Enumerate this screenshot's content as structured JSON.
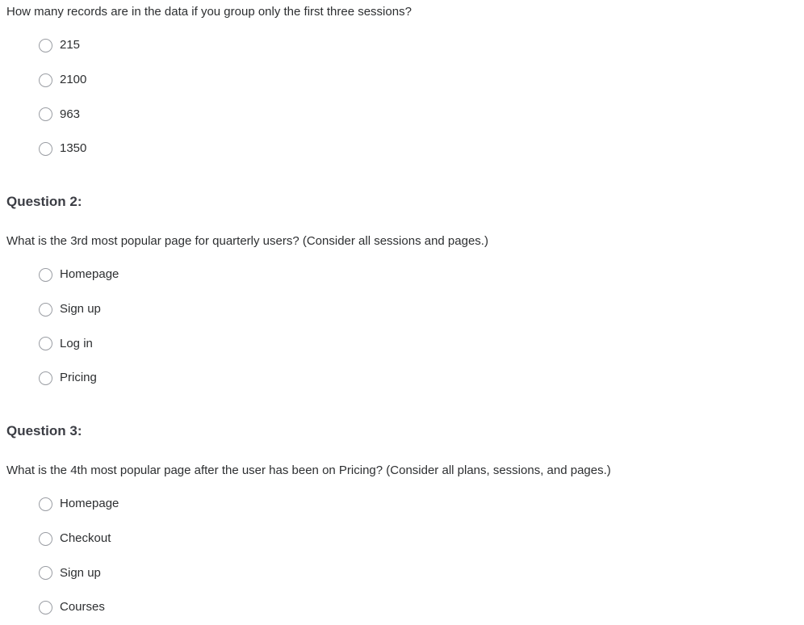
{
  "questions": [
    {
      "heading": "",
      "prompt": "How many records are in the data if you group only the first three sessions?",
      "options": [
        {
          "label": "215"
        },
        {
          "label": "2100"
        },
        {
          "label": "963"
        },
        {
          "label": "1350"
        }
      ]
    },
    {
      "heading": "Question 2:",
      "prompt": "What is the 3rd most popular page for quarterly users? (Consider all sessions and pages.)",
      "options": [
        {
          "label": "Homepage"
        },
        {
          "label": "Sign up"
        },
        {
          "label": "Log in"
        },
        {
          "label": "Pricing"
        }
      ]
    },
    {
      "heading": "Question 3:",
      "prompt": "What is the 4th most popular page after the user has been on Pricing? (Consider all plans, sessions, and pages.)",
      "options": [
        {
          "label": "Homepage"
        },
        {
          "label": "Checkout"
        },
        {
          "label": "Sign up"
        },
        {
          "label": "Courses"
        }
      ]
    }
  ]
}
